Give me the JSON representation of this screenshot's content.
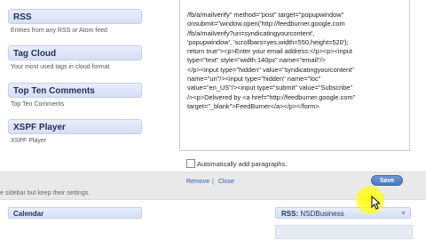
{
  "widgets": [
    {
      "title": "RSS",
      "description": "Entries from any RSS or Atom feed"
    },
    {
      "title": "Tag Cloud",
      "description": "Your most used tags in cloud format"
    },
    {
      "title": "Top Ten Comments",
      "description": "Top Ten Comments"
    },
    {
      "title": "XSPF Player",
      "description": "XSPF Player"
    }
  ],
  "left_note": "e sidebar but keep their settings.",
  "calendar": {
    "title": "Calendar"
  },
  "editor": {
    "code": "/fb/a/mailverify\" method=\"post\" target=\"popupwindow\"\nonsubmit=\"window.open('http://feedburner.google.com\n/fb/a/mailverify?uri=syndicatingyourcontent',\n'popupwindow', 'scrollbars=yes,width=550,height=520');\nreturn true\"><p>Enter your email address:</p><p><input\ntype=\"text\" style=\"width:140px\" name=\"email\"/>\n</p><input type=\"hidden\" value=\"syndicatingyourcontent\"\nname=\"uri\"/><input type=\"hidden\" name=\"loc\"\nvalue=\"en_US\"/><input type=\"submit\" value=\"Subscribe\"\n/><p>Delivered by <a href=\"http://feedburner.google.com\"\ntarget=\"_blank\">FeedBurner</a></p></form>",
    "auto_paragraphs_label": "Automatically add paragraphs.",
    "remove_label": "Remove",
    "separator": "|",
    "close_label": "Close",
    "save_label": "Save"
  },
  "right_widget": {
    "prefix": "RSS:",
    "name": " NSDBusiness"
  },
  "icons": {
    "dropdown": "dropdown-arrow-icon",
    "cursor": "mouse-pointer-icon"
  },
  "colors": {
    "accent": "#4b78bd",
    "widget_bg": "#dfe6f8",
    "highlight": "#ffff00"
  }
}
